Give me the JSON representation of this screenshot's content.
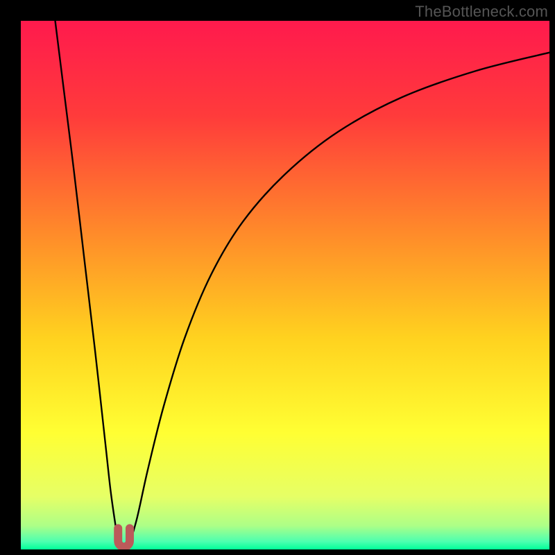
{
  "watermark": "TheBottleneck.com",
  "colors": {
    "frame": "#000000",
    "curve_stroke": "#000000",
    "marker_fill": "#bb5a5a",
    "gradient_stops": [
      {
        "offset": 0.0,
        "color": "#ff1a4d"
      },
      {
        "offset": 0.18,
        "color": "#ff3b3b"
      },
      {
        "offset": 0.4,
        "color": "#ff8a2a"
      },
      {
        "offset": 0.6,
        "color": "#ffd21f"
      },
      {
        "offset": 0.78,
        "color": "#ffff33"
      },
      {
        "offset": 0.9,
        "color": "#e6ff66"
      },
      {
        "offset": 0.955,
        "color": "#adff87"
      },
      {
        "offset": 0.985,
        "color": "#4dffb0"
      },
      {
        "offset": 1.0,
        "color": "#00ff99"
      }
    ]
  },
  "chart_data": {
    "type": "line",
    "title": "",
    "xlabel": "",
    "ylabel": "",
    "xlim": [
      0,
      100
    ],
    "ylim": [
      0,
      100
    ],
    "series": [
      {
        "name": "left-branch",
        "x": [
          6.5,
          8,
          10,
          12,
          14,
          16,
          17,
          18,
          18.6
        ],
        "values": [
          100,
          88,
          72,
          55,
          38,
          20,
          11,
          4,
          0.5
        ]
      },
      {
        "name": "right-branch",
        "x": [
          20.4,
          22,
          24,
          27,
          31,
          36,
          42,
          50,
          60,
          72,
          86,
          100
        ],
        "values": [
          0.5,
          6,
          15,
          27,
          40,
          52,
          62,
          71,
          79,
          85.5,
          90.5,
          94
        ]
      }
    ],
    "marker": {
      "name": "u-shaped-minimum-marker",
      "x_center": 19.5,
      "x_half_width": 1.1,
      "y_top": 4.0,
      "y_bottom": 0.5
    }
  }
}
